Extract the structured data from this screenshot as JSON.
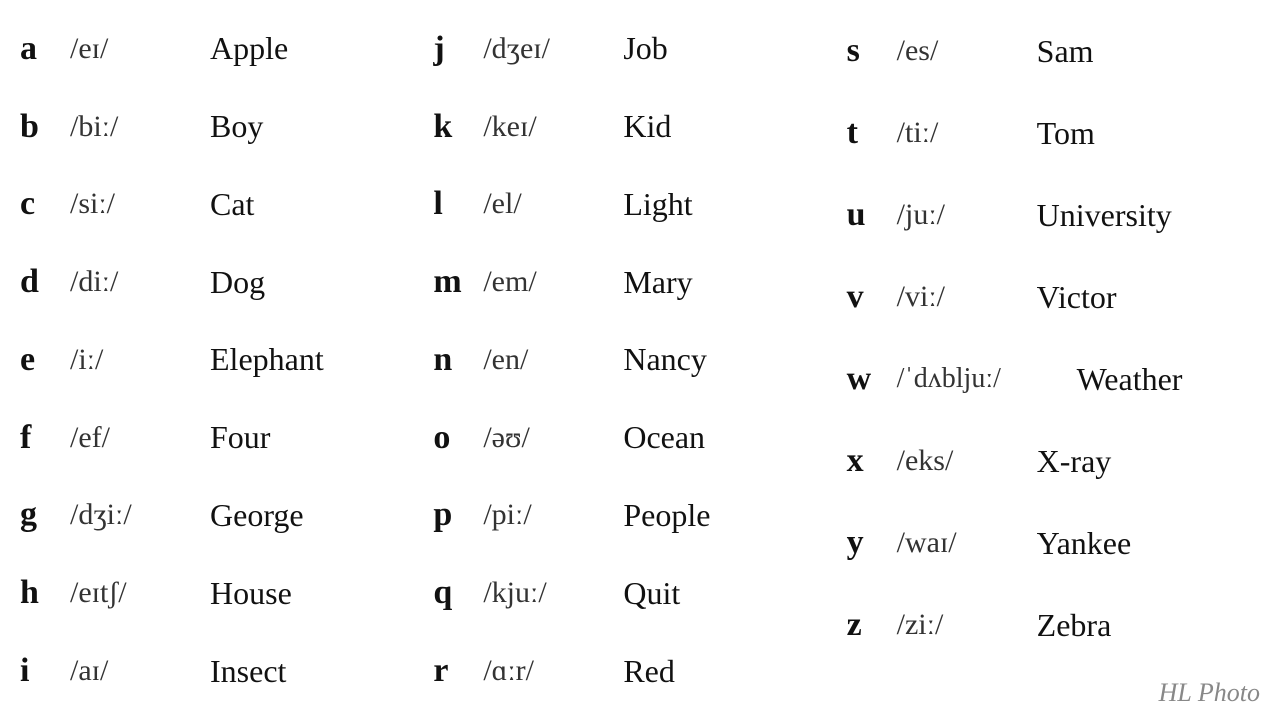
{
  "columns": [
    {
      "id": "col1",
      "rows": [
        {
          "letter": "a",
          "phonetic": "/eɪ/",
          "word": "Apple"
        },
        {
          "letter": "b",
          "phonetic": "/biː/",
          "word": "Boy"
        },
        {
          "letter": "c",
          "phonetic": "/siː/",
          "word": "Cat"
        },
        {
          "letter": "d",
          "phonetic": "/diː/",
          "word": "Dog"
        },
        {
          "letter": "e",
          "phonetic": "/iː/",
          "word": "Elephant"
        },
        {
          "letter": "f",
          "phonetic": "/ef/",
          "word": "Four"
        },
        {
          "letter": "g",
          "phonetic": "/dʒiː/",
          "word": "George"
        },
        {
          "letter": "h",
          "phonetic": "/eɪtʃ/",
          "word": "House"
        },
        {
          "letter": "i",
          "phonetic": "/aɪ/",
          "word": "Insect"
        }
      ]
    },
    {
      "id": "col2",
      "rows": [
        {
          "letter": "j",
          "phonetic": "/dʒeɪ/",
          "word": "Job"
        },
        {
          "letter": "k",
          "phonetic": "/keɪ/",
          "word": "Kid"
        },
        {
          "letter": "l",
          "phonetic": "/el/",
          "word": "Light"
        },
        {
          "letter": "m",
          "phonetic": "/em/",
          "word": "Mary"
        },
        {
          "letter": "n",
          "phonetic": "/en/",
          "word": "Nancy"
        },
        {
          "letter": "o",
          "phonetic": "/əʊ/",
          "word": "Ocean"
        },
        {
          "letter": "p",
          "phonetic": "/piː/",
          "word": "People"
        },
        {
          "letter": "q",
          "phonetic": "/kjuː/",
          "word": "Quit"
        },
        {
          "letter": "r",
          "phonetic": "/ɑːr/",
          "word": "Red"
        }
      ]
    },
    {
      "id": "col3",
      "rows": [
        {
          "letter": "s",
          "phonetic": "/es/",
          "word": "Sam"
        },
        {
          "letter": "t",
          "phonetic": "/tiː/",
          "word": "Tom"
        },
        {
          "letter": "u",
          "phonetic": "/juː/",
          "word": "University"
        },
        {
          "letter": "v",
          "phonetic": "/viː/",
          "word": "Victor"
        },
        {
          "letter": "w",
          "phonetic": "/ˈdʌbljuː/",
          "word": "Weather"
        },
        {
          "letter": "x",
          "phonetic": "/eks/",
          "word": "X-ray"
        },
        {
          "letter": "y",
          "phonetic": "/waɪ/",
          "word": "Yankee"
        },
        {
          "letter": "z",
          "phonetic": "/ziː/",
          "word": "Zebra"
        },
        {
          "letter": "",
          "phonetic": "",
          "word": ""
        }
      ]
    }
  ],
  "watermark": "HL Photo"
}
